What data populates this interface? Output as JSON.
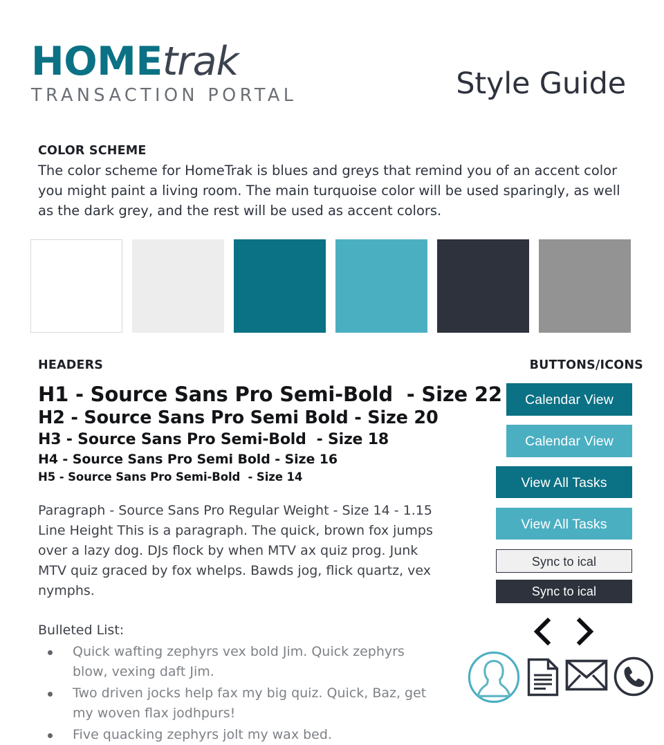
{
  "header": {
    "logo": {
      "primary": "HOME",
      "secondary": "trak",
      "subtitle": "TRANSACTION PORTAL"
    },
    "title": "Style Guide"
  },
  "color_scheme": {
    "section_title": "COLOR SCHEME",
    "description": "The color scheme for HomeTrak is blues and greys that remind you of an accent color you might paint a living room. The main turquoise color will be used sparingly, as well as the dark grey, and the rest will be used as accent colors.",
    "swatches": [
      {
        "name": "white",
        "hex": "#ffffff",
        "bordered": true
      },
      {
        "name": "light-grey",
        "hex": "#ededed",
        "bordered": false
      },
      {
        "name": "teal-dark",
        "hex": "#0b7184",
        "bordered": false
      },
      {
        "name": "teal-light",
        "hex": "#4bafc2",
        "bordered": false
      },
      {
        "name": "navy-dark",
        "hex": "#2d323d",
        "bordered": false
      },
      {
        "name": "grey-mid",
        "hex": "#939393",
        "bordered": false
      }
    ]
  },
  "headers_section": {
    "section_title": "HEADERS",
    "samples": [
      "H1 - Source Sans Pro Semi-Bold  - Size 22",
      "H2 - Source Sans Pro Semi Bold - Size 20",
      "H3 - Source Sans Pro Semi-Bold  - Size 18",
      "H4 - Source Sans Pro Semi Bold - Size 16",
      "H5 - Source Sans Pro Semi-Bold  - Size 14"
    ],
    "paragraph": "Paragraph - Source Sans Pro Regular Weight - Size 14 - 1.15 Line Height This is a paragraph. The quick, brown fox jumps over a lazy dog. DJs flock by when MTV ax quiz prog. Junk MTV quiz graced by fox whelps. Bawds jog, flick quartz, vex nymphs.",
    "bullet_intro": "Bulleted List:",
    "bullets": [
      "Quick wafting zephyrs vex bold Jim. Quick zephyrs blow, vexing daft Jim.",
      "Two driven jocks help fax my big quiz. Quick, Baz, get my woven flax jodhpurs!",
      "Five quacking zephyrs jolt my wax bed."
    ]
  },
  "buttons_section": {
    "section_title": "BUTTONS/ICONS",
    "buttons": [
      {
        "label": "Calendar View",
        "style": "teal-dark"
      },
      {
        "label": "Calendar View",
        "style": "teal-light"
      },
      {
        "label": "View All Tasks",
        "style": "teal-dark"
      },
      {
        "label": "View All Tasks",
        "style": "teal-light"
      },
      {
        "label": "Sync to ical",
        "style": "grey-light"
      },
      {
        "label": "Sync to ical",
        "style": "navy-dark"
      }
    ],
    "icons": [
      "chevron-left-icon",
      "chevron-right-icon",
      "user-avatar-icon",
      "document-icon",
      "envelope-icon",
      "phone-icon"
    ]
  }
}
